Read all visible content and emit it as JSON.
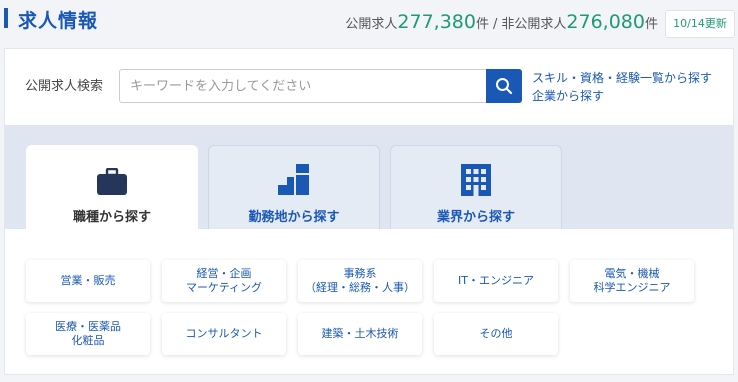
{
  "header": {
    "title": "求人情報",
    "public_label": "公開求人",
    "public_count": "277,380",
    "public_unit": "件",
    "separator": "/",
    "private_label": "非公開求人",
    "private_count": "276,080",
    "private_unit": "件",
    "updated": "10/14更新"
  },
  "search": {
    "label": "公開求人検索",
    "placeholder": "キーワードを入力してください",
    "value": "",
    "button_icon": "search-icon",
    "links": [
      "スキル・資格・経験一覧から探す",
      "企業から探す"
    ]
  },
  "tabs": [
    {
      "label": "職種から探す",
      "icon": "briefcase-icon",
      "active": true
    },
    {
      "label": "勤務地から探す",
      "icon": "map-blocks-icon",
      "active": false
    },
    {
      "label": "業界から探す",
      "icon": "building-icon",
      "active": false
    }
  ],
  "categories": [
    "営業・販売",
    "経営・企画\nマーケティング",
    "事務系\n（経理・総務・人事）",
    "IT・エンジニア",
    "電気・機械\n科学エンジニア",
    "医療・医薬品\n化粧品",
    "コンサルタント",
    "建築・土木技術",
    "その他"
  ],
  "colors": {
    "accent": "#1a58b6",
    "count_green": "#1f9a74",
    "tab_bg": "#dfe6f1",
    "icon_dark": "#26365a"
  }
}
